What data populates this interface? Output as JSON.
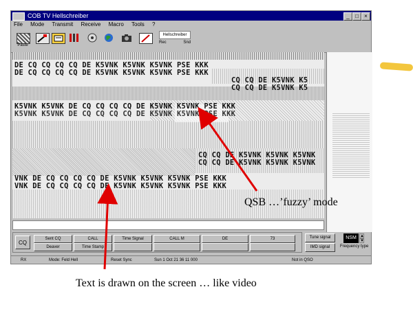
{
  "window": {
    "title": "COB TV Hellschreiber",
    "controls": [
      "_",
      "□",
      "×"
    ]
  },
  "menu": [
    "File",
    "Mode",
    "Transmit",
    "Receive",
    "Macro",
    "Tools",
    "?"
  ],
  "toolbar": {
    "buttons": [
      {
        "icon": "paste-icon",
        "label": "Paste"
      },
      {
        "icon": "edit-icon",
        "label": ""
      },
      {
        "icon": "settings-icon",
        "label": ""
      },
      {
        "icon": "tools-icon",
        "label": ""
      },
      {
        "icon": "config-icon",
        "label": ""
      },
      {
        "icon": "globe-icon",
        "label": ""
      },
      {
        "icon": "camera-icon",
        "label": ""
      },
      {
        "icon": "notepad-icon",
        "label": ""
      }
    ],
    "mode_select": "Hellschreiber",
    "mode_sub_left": "Rec",
    "mode_sub_right": "Snd"
  },
  "screen": {
    "lines": [
      "DE CQ CQ CQ CQ DE K5VNK K5VNK K5VNK PSE KKK",
      "DE CQ CQ CQ CQ DE K5VNK K5VNK K5VNK PSE KKK",
      "CQ CQ DE K5VNK K5",
      "CQ CQ DE K5VNK K5",
      "K5VNK K5VNK DE CQ CQ CQ CQ DE K5VNK K5VNK PSE KKK",
      "K5VNK K5VNK DE CQ CQ CQ CQ DE K5VNK K5VNK PSE KKK",
      "CQ CQ DE K5VNK K5VNK K5VNK",
      "CQ CQ DE K5VNK K5VNK K5VNK",
      "VNK DE CQ CQ CQ CQ DE K5VNK K5VNK K5VNK PSE KKK",
      "VNK DE CQ CQ CQ CQ DE K5VNK K5VNK K5VNK PSE KKK"
    ]
  },
  "buttons_panel": {
    "cq_label": "CQ",
    "function_keys": [
      "Sent CQ",
      "CALL",
      "Time Signal",
      "CALL M",
      "DE",
      "73",
      "Deaver",
      "Time Stamp"
    ]
  },
  "side_panel": {
    "btn1": "Tune signal",
    "btn2": "IMD signal",
    "mode_display": "NSM",
    "mode_label": "Frequency type"
  },
  "statusbar": {
    "left": "RX",
    "mode": "Mode: Feld Hell",
    "sync": "Reset Sync",
    "time": "Sun 1 Oct 21 36 11 000",
    "right": "Not in QSO"
  },
  "annotations": {
    "qsb": "QSB …’fuzzy’ mode",
    "text": "Text is drawn on the screen … like video"
  }
}
